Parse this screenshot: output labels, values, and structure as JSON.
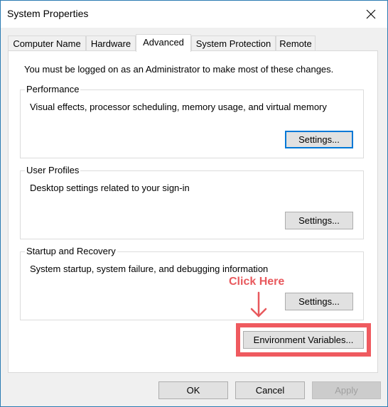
{
  "window": {
    "title": "System Properties",
    "close_icon": "close-icon"
  },
  "tabs": [
    {
      "label": "Computer Name",
      "active": false
    },
    {
      "label": "Hardware",
      "active": false
    },
    {
      "label": "Advanced",
      "active": true
    },
    {
      "label": "System Protection",
      "active": false
    },
    {
      "label": "Remote",
      "active": false
    }
  ],
  "advanced": {
    "notice": "You must be logged on as an Administrator to make most of these changes.",
    "groups": [
      {
        "label": "Performance",
        "description": "Visual effects, processor scheduling, memory usage, and virtual memory",
        "button": "Settings..."
      },
      {
        "label": "User Profiles",
        "description": "Desktop settings related to your sign-in",
        "button": "Settings..."
      },
      {
        "label": "Startup and Recovery",
        "description": "System startup, system failure, and debugging information",
        "button": "Settings..."
      }
    ],
    "env_button": "Environment Variables..."
  },
  "annotation": {
    "text": "Click Here",
    "color": "#e8595d",
    "icon": "arrow-down-icon"
  },
  "footer": {
    "ok": "OK",
    "cancel": "Cancel",
    "apply": "Apply",
    "apply_disabled": true
  },
  "colors": {
    "accent": "#0078d7",
    "window_border": "#2b7bb3",
    "highlight": "#ef5a5f"
  }
}
